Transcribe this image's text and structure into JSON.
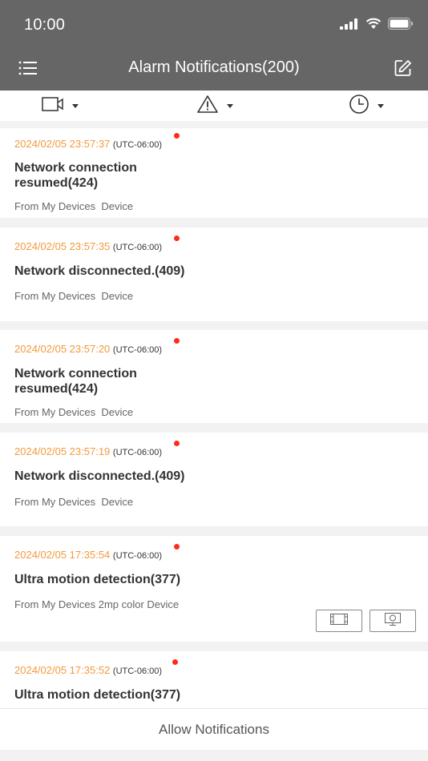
{
  "status_bar": {
    "time": "10:00"
  },
  "nav": {
    "title": "Alarm Notifications(200)",
    "menu_icon": "list-menu-icon",
    "edit_icon": "edit-icon"
  },
  "filters": [
    {
      "name": "camera-filter",
      "icon": "camera-icon"
    },
    {
      "name": "alarm-type-filter",
      "icon": "warning-icon"
    },
    {
      "name": "time-filter",
      "icon": "clock-icon"
    }
  ],
  "notifications": [
    {
      "time": "2024/02/05 23:57:37",
      "tz": "(UTC-06:00)",
      "title": "Network connection resumed(424)",
      "from": "From My Devices  Device",
      "unread": true
    },
    {
      "time": "2024/02/05 23:57:35",
      "tz": "(UTC-06:00)",
      "title": "Network disconnected.(409)",
      "from": "From My Devices  Device",
      "unread": true
    },
    {
      "time": "2024/02/05 23:57:20",
      "tz": "(UTC-06:00)",
      "title": "Network connection resumed(424)",
      "from": "From My Devices  Device",
      "unread": true
    },
    {
      "time": "2024/02/05 23:57:19",
      "tz": "(UTC-06:00)",
      "title": "Network disconnected.(409)",
      "from": "From My Devices  Device",
      "unread": true
    },
    {
      "time": "2024/02/05 17:35:54",
      "tz": "(UTC-06:00)",
      "title": "Ultra motion detection(377)",
      "from": "From My Devices 2mp color Device",
      "unread": true,
      "actions": [
        "video-clip-icon",
        "snapshot-icon"
      ]
    },
    {
      "time": "2024/02/05 17:35:52",
      "tz": "(UTC-06:00)",
      "title": "Ultra motion detection(377)",
      "unread": true
    }
  ],
  "footer": {
    "allow_notifications": "Allow Notifications"
  },
  "colors": {
    "header_bg": "#666666",
    "timestamp": "#f39a3d",
    "unread_dot": "#ff2b1a",
    "page_bg": "#f2f2f2"
  }
}
